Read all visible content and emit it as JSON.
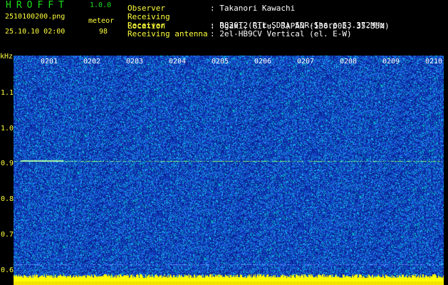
{
  "header": {
    "app_title": "HROFFT",
    "version": "1.0.0",
    "filename": "2510100200.png",
    "datetime": "25.10.10 02:00",
    "meteor_label": "meteor",
    "meteor_count": "98"
  },
  "info": [
    {
      "key": "Observer",
      "value": ": Takanori Kawachi"
    },
    {
      "key": "Receiving Location",
      "value": ": Ogaki, Gifu, JAPAN (136.60E, 35.35N)"
    },
    {
      "key": "Receiver",
      "value": ": R820T2(RTL-SDR) SDR-Sharp 53.372MHz"
    },
    {
      "key": "Receiving antenna",
      "value": ": 2el-HB9CV Vertical (el. E-W)"
    }
  ],
  "axis": {
    "unit": "kHz",
    "y_ticks": [
      "1.1",
      "1.0",
      "0.9",
      "0.8",
      "0.7",
      "0.6"
    ],
    "x_ticks": [
      "0201",
      "0202",
      "0203",
      "0204",
      "0205",
      "0206",
      "0207",
      "0208",
      "0209",
      "0210"
    ]
  },
  "colors": {
    "background": "#000000",
    "text_green": "#19e019",
    "text_yellow": "#ffff3c",
    "text_white": "#ffffff",
    "spectrum_base": "#0a1e8c",
    "spectrum_noise": "#2a8cff",
    "spectrum_hot": "#00e6c8",
    "meteor_trace": "#7cff7c",
    "bottom_band": "#ffff00"
  }
}
